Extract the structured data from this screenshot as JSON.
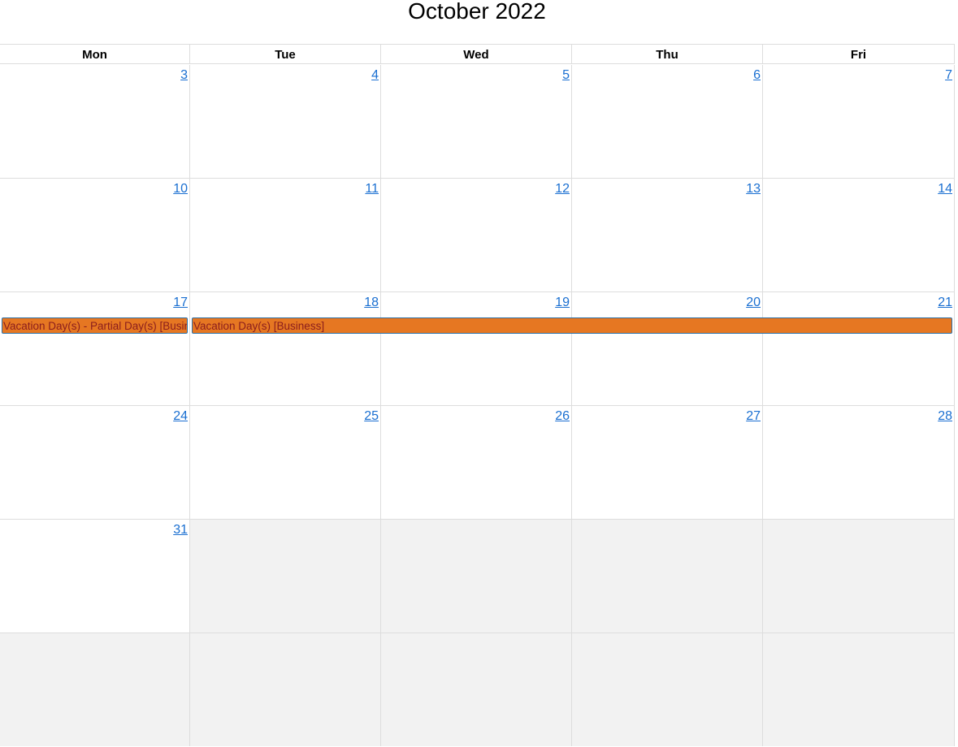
{
  "calendar": {
    "title": "October 2022",
    "weekdays": [
      "Mon",
      "Tue",
      "Wed",
      "Thu",
      "Fri"
    ],
    "weeks": [
      [
        "3",
        "4",
        "5",
        "6",
        "7"
      ],
      [
        "10",
        "11",
        "12",
        "13",
        "14"
      ],
      [
        "17",
        "18",
        "19",
        "20",
        "21"
      ],
      [
        "24",
        "25",
        "26",
        "27",
        "28"
      ],
      [
        "31",
        "",
        "",
        "",
        ""
      ]
    ],
    "events": [
      "Vacation Day(s) - Partial Day(s) [Business]",
      "Vacation Day(s) [Business]"
    ],
    "colors": {
      "event_bg": "#e67722",
      "event_text": "#8a1d1d",
      "link": "#1a6fd1",
      "other_month_bg": "#f2f2f2"
    }
  }
}
